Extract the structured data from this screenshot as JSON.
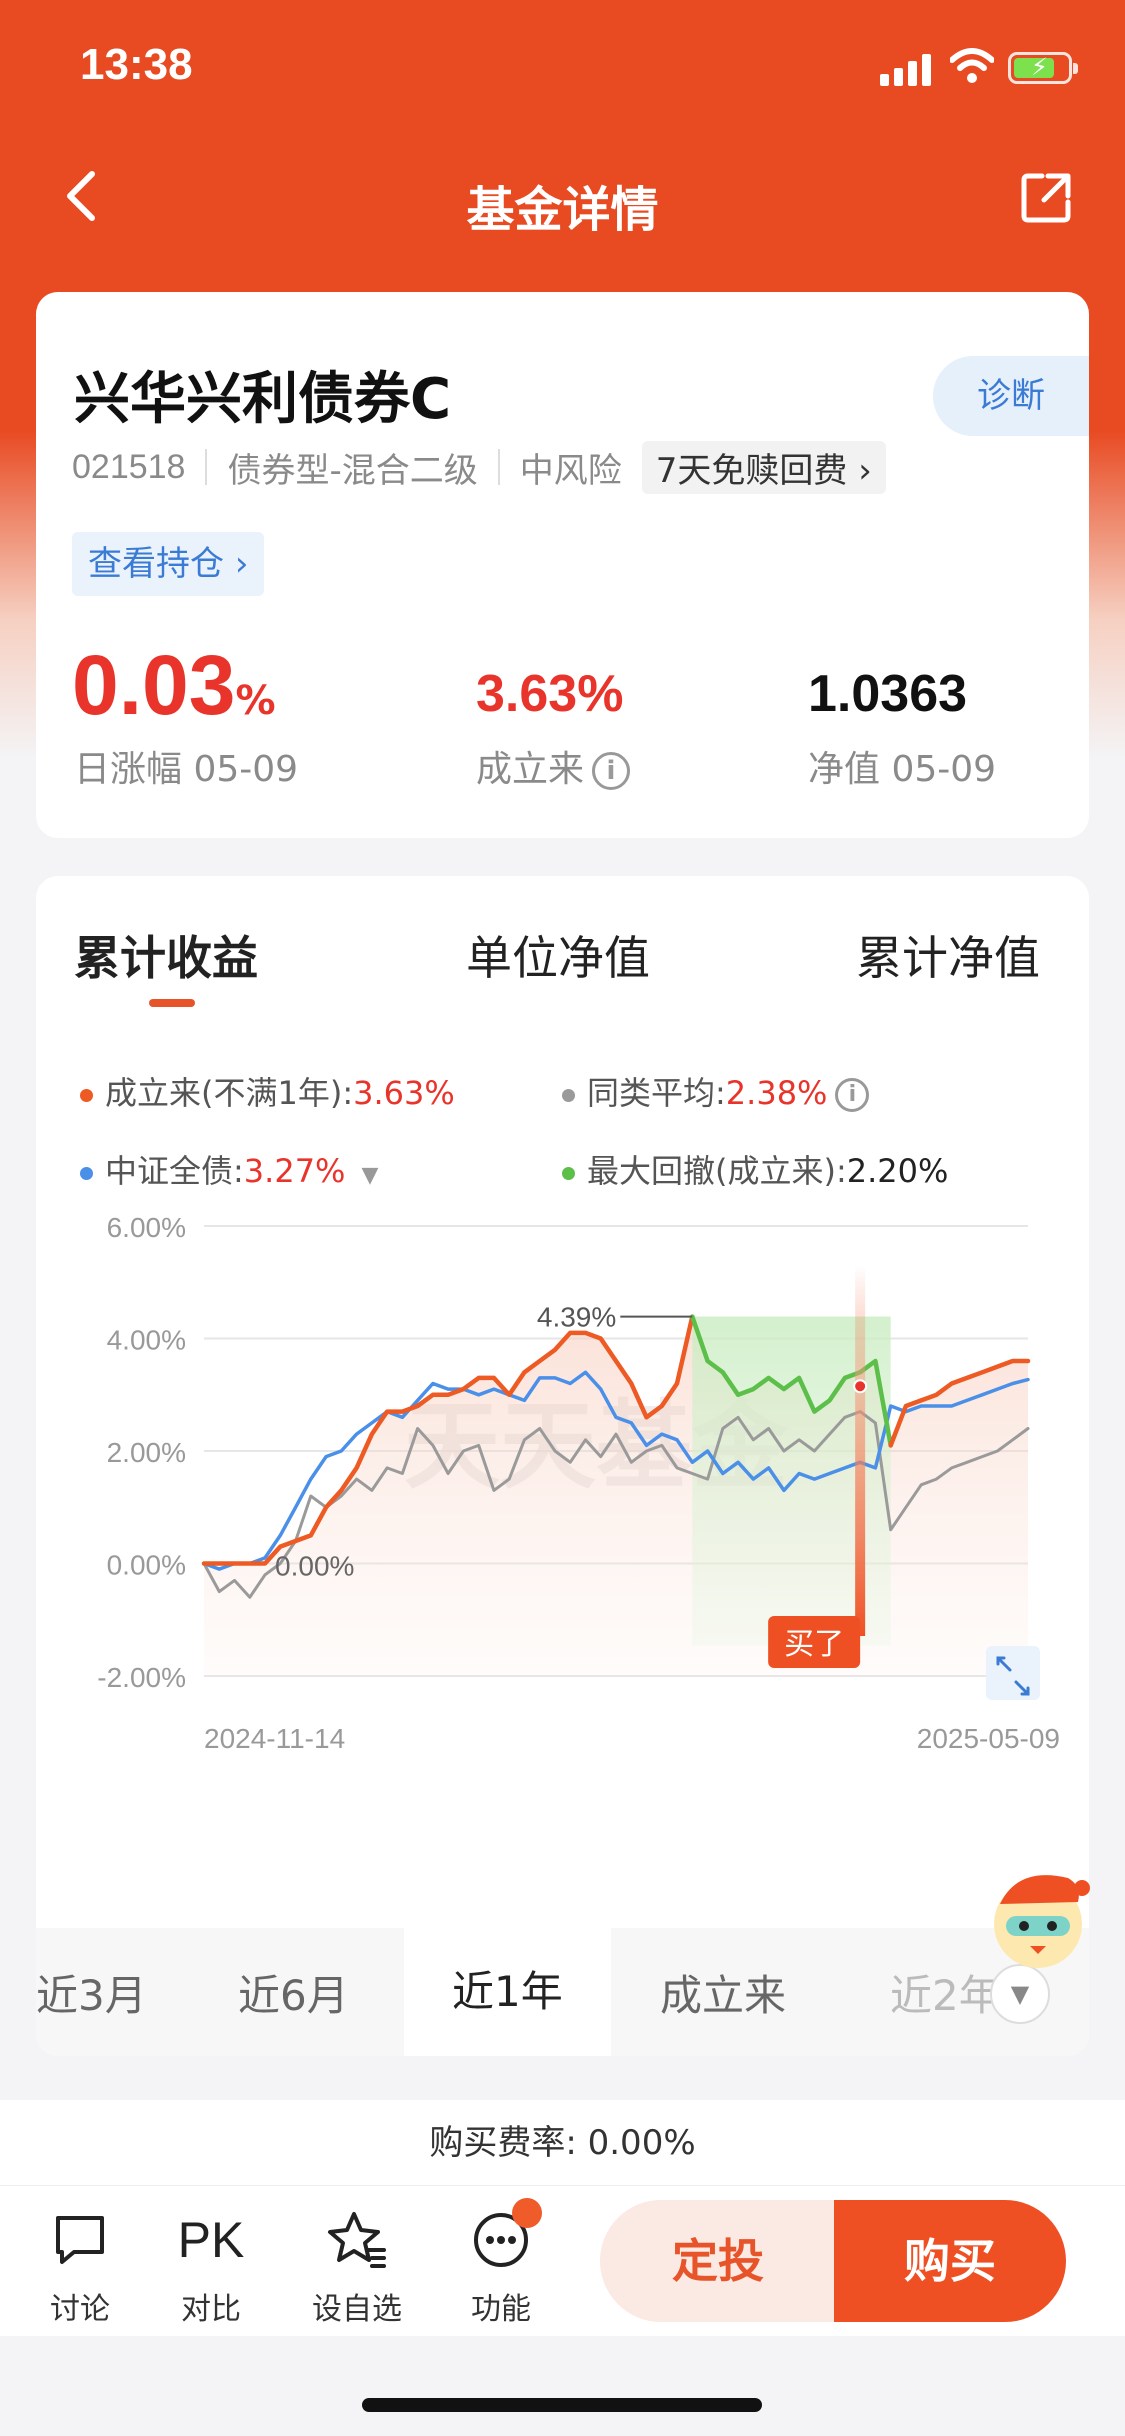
{
  "status": {
    "time": "13:38"
  },
  "nav": {
    "title": "基金详情"
  },
  "fund": {
    "name": "兴华兴利债券C",
    "diagnose": "诊断",
    "code": "021518",
    "type": "债券型-混合二级",
    "risk": "中风险",
    "fee_tag": "7天免赎回费",
    "holdings": "查看持仓"
  },
  "stats": {
    "daily_value": "0.03",
    "daily_unit": "%",
    "daily_label": "日涨幅 05-09",
    "since_value": "3.63%",
    "since_label": "成立来",
    "nav_value": "1.0363",
    "nav_label": "净值 05-09"
  },
  "tabs": [
    "累计收益",
    "单位净值",
    "累计净值"
  ],
  "legend": {
    "fund_label": "成立来(不满1年):",
    "fund_value": "3.63%",
    "peer_label": "同类平均:",
    "peer_value": "2.38%",
    "index_label": "中证全债:",
    "index_value": "3.27%",
    "dd_label": "最大回撤(成立来):",
    "dd_value": "2.20%"
  },
  "colors": {
    "fund": "#ee5a24",
    "peer": "#9a9a9a",
    "index": "#4a8fe8",
    "drawdown": "#5cbf4a"
  },
  "chart_data": {
    "type": "line",
    "y_ticks": [
      "6.00%",
      "4.00%",
      "2.00%",
      "0.00%",
      "-2.00%"
    ],
    "ylim": [
      -2,
      6
    ],
    "x_start_label": "2024-11-14",
    "x_end_label": "2025-05-09",
    "peak_label": "4.39%",
    "start_label": "0.00%",
    "buy_label": "买了",
    "watermark": "天天基金",
    "series": [
      {
        "name": "成立来",
        "values": [
          0,
          0,
          0,
          0,
          0,
          0.3,
          0.4,
          0.5,
          1.0,
          1.3,
          1.7,
          2.3,
          2.7,
          2.7,
          2.8,
          3.0,
          3.0,
          3.1,
          3.3,
          3.3,
          3.0,
          3.4,
          3.6,
          3.8,
          4.1,
          4.1,
          4.0,
          3.6,
          3.2,
          2.6,
          2.8,
          3.2,
          4.39,
          3.6,
          3.4,
          3.0,
          3.1,
          3.3,
          3.1,
          3.3,
          2.7,
          2.9,
          3.3,
          3.4,
          3.6,
          2.1,
          2.8,
          2.9,
          3.0,
          3.2,
          3.3,
          3.4,
          3.5,
          3.6,
          3.6
        ]
      },
      {
        "name": "中证全债",
        "values": [
          0,
          -0.1,
          0,
          0,
          0.1,
          0.5,
          1.0,
          1.5,
          1.9,
          2.0,
          2.3,
          2.5,
          2.7,
          2.6,
          2.9,
          3.2,
          3.1,
          3.1,
          3.0,
          3.1,
          3.0,
          2.9,
          3.3,
          3.3,
          3.2,
          3.4,
          3.1,
          2.6,
          2.5,
          2.1,
          2.3,
          2.2,
          1.8,
          2.0,
          1.6,
          1.8,
          1.5,
          1.7,
          1.3,
          1.6,
          1.5,
          1.6,
          1.7,
          1.8,
          1.7,
          2.8,
          2.7,
          2.8,
          2.8,
          2.8,
          2.9,
          3.0,
          3.1,
          3.2,
          3.27
        ]
      },
      {
        "name": "同类平均",
        "values": [
          0,
          -0.5,
          -0.3,
          -0.6,
          -0.2,
          0,
          0.4,
          1.2,
          1.0,
          1.2,
          1.5,
          1.3,
          1.7,
          1.6,
          2.4,
          2.1,
          1.6,
          2.0,
          2.1,
          1.3,
          1.5,
          2.2,
          2.4,
          2.0,
          1.8,
          2.2,
          1.9,
          2.3,
          1.8,
          2.0,
          2.1,
          1.7,
          1.6,
          1.5,
          2.4,
          2.6,
          2.2,
          2.4,
          2.0,
          2.2,
          2.0,
          2.3,
          2.6,
          2.7,
          2.5,
          0.6,
          1.0,
          1.4,
          1.5,
          1.7,
          1.8,
          1.9,
          2.0,
          2.2,
          2.4
        ]
      }
    ],
    "max_drawdown": {
      "from_index": 32,
      "to_index": 45,
      "value": "2.20%"
    },
    "buy_index": 43
  },
  "ranges": [
    "近3月",
    "近6月",
    "近1年",
    "成立来",
    "近2年"
  ],
  "fee": {
    "text": "购买费率: 0.00%"
  },
  "bottom": {
    "discuss": "讨论",
    "pk_icon": "PK",
    "compare": "对比",
    "watch": "设自选",
    "func": "功能",
    "dingtou": "定投",
    "buy": "购买"
  }
}
